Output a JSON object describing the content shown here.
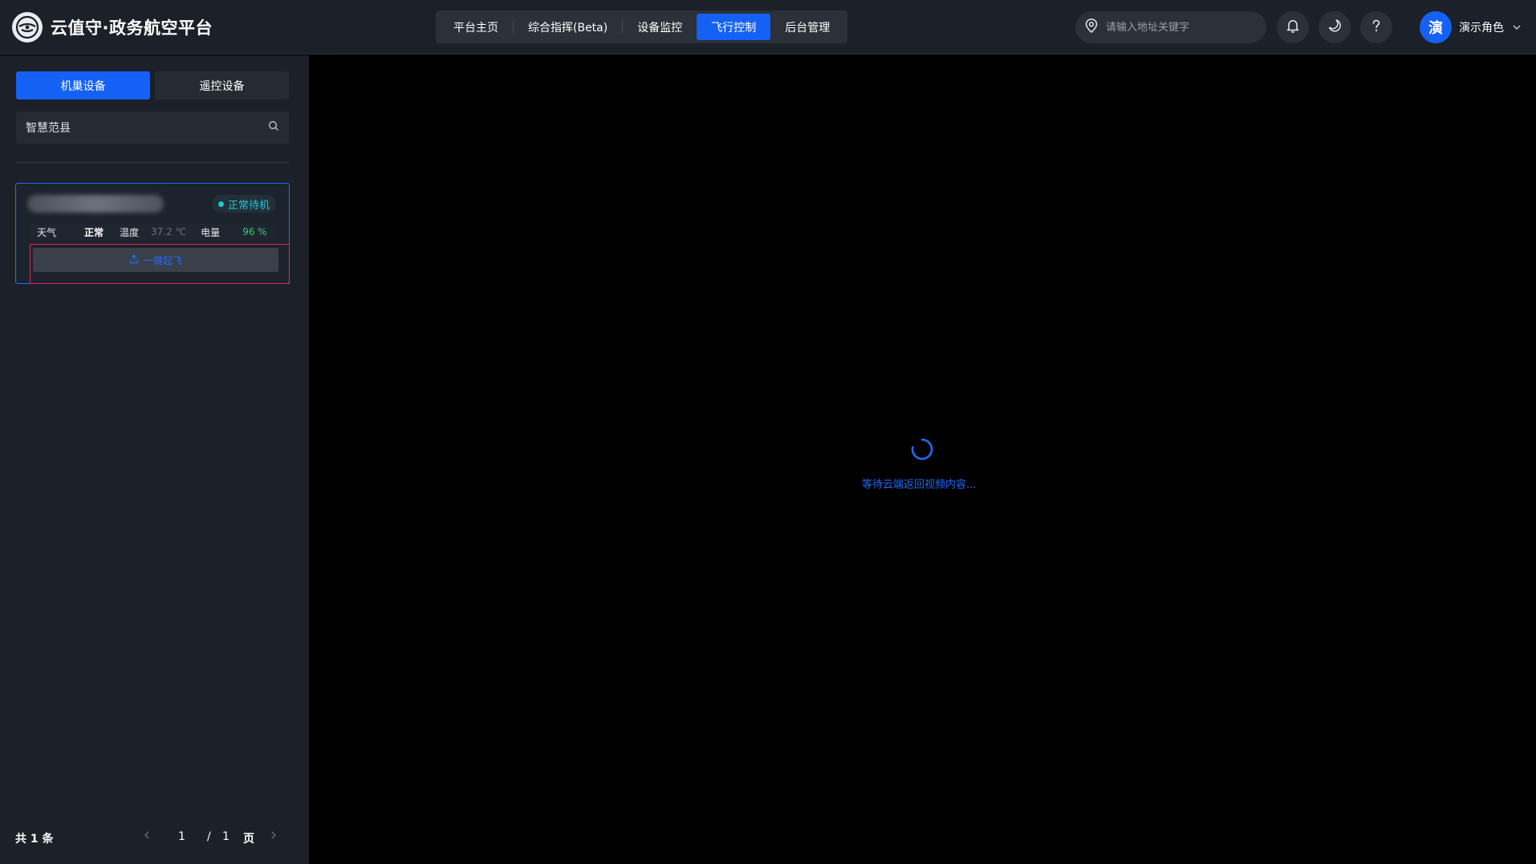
{
  "app": {
    "title": "云值守·政务航空平台"
  },
  "nav": {
    "items": [
      {
        "label": "平台主页",
        "active": false
      },
      {
        "label": "综合指挥(Beta)",
        "active": false
      },
      {
        "label": "设备监控",
        "active": false
      },
      {
        "label": "飞行控制",
        "active": true
      },
      {
        "label": "后台管理",
        "active": false
      }
    ]
  },
  "search": {
    "placeholder": "请输入地址关键字"
  },
  "user": {
    "avatar_char": "演",
    "name": "演示角色"
  },
  "sidebar": {
    "tabs": [
      {
        "label": "机巢设备",
        "active": true
      },
      {
        "label": "遥控设备",
        "active": false
      }
    ],
    "area": "智慧范县",
    "device": {
      "status": "正常待机",
      "weather_label": "天气",
      "weather_value": "正常",
      "temp_label": "温度",
      "temp_value": "37.2 ℃",
      "battery_label": "电量",
      "battery_value": "96 %",
      "launch_label": "一键起飞"
    },
    "pager": {
      "total": "共 1 条",
      "current": "1",
      "sep": "/",
      "pages": "1",
      "unit": "页"
    }
  },
  "video": {
    "waiting_text": "等待云端返回视频内容..."
  },
  "colors": {
    "accent": "#1561f5",
    "status": "#1ec9d6",
    "battery": "#2ecc71",
    "highlight": "#e0245e"
  }
}
